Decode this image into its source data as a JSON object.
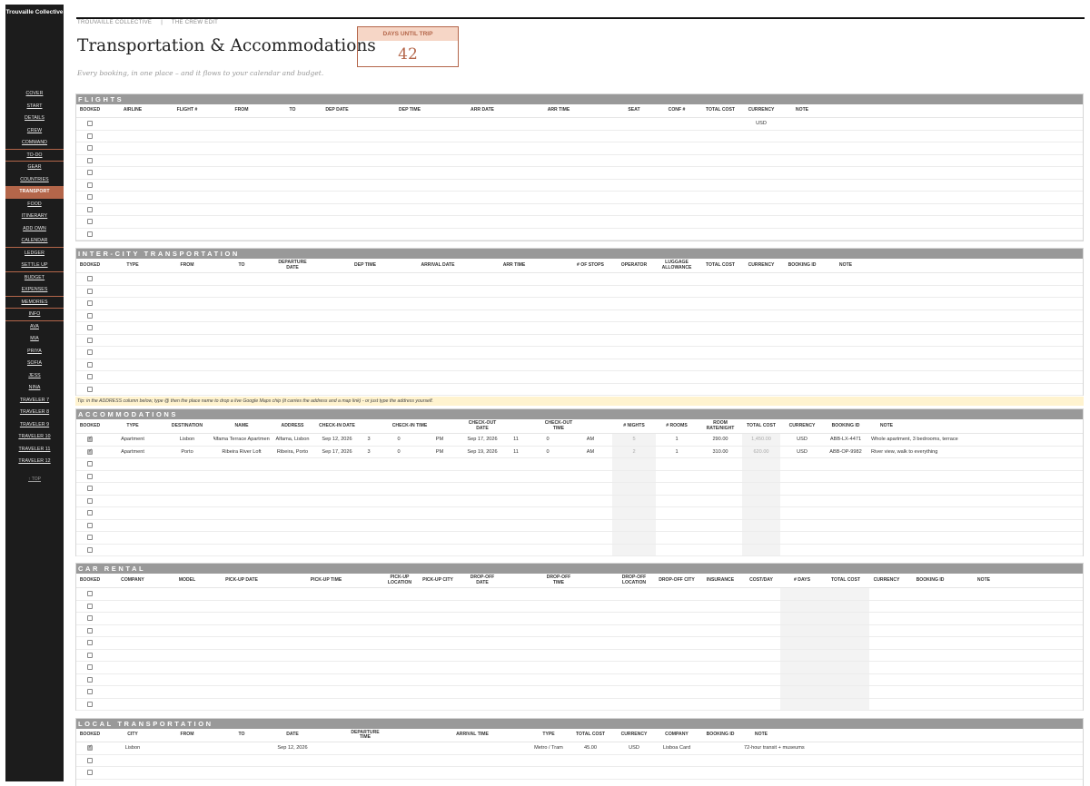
{
  "sidebar": {
    "brand": "Trouvaille Collective",
    "items": [
      {
        "label": "COVER"
      },
      {
        "label": "START"
      },
      {
        "label": "DETAILS"
      },
      {
        "label": "CREW"
      },
      {
        "label": "COMMAND"
      },
      {
        "label": "TO-DO"
      },
      {
        "label": "GEAR"
      },
      {
        "label": "COUNTRIES"
      },
      {
        "label": "TRANSPORT"
      },
      {
        "label": "FOOD"
      },
      {
        "label": "ITINERARY"
      },
      {
        "label": "ADD OWN"
      },
      {
        "label": "CALENDAR"
      },
      {
        "label": "LEDGER"
      },
      {
        "label": "SETTLE UP"
      },
      {
        "label": "BUDGET"
      },
      {
        "label": "EXPENSES"
      },
      {
        "label": "MEMORIES"
      },
      {
        "label": "INFO"
      },
      {
        "label": "AVA"
      },
      {
        "label": "MIA"
      },
      {
        "label": "PRIYA"
      },
      {
        "label": "SOFIA"
      },
      {
        "label": "JESS"
      },
      {
        "label": "NINA"
      },
      {
        "label": "TRAVELER 7"
      },
      {
        "label": "TRAVELER 8"
      },
      {
        "label": "TRAVELER 9"
      },
      {
        "label": "TRAVELER 10"
      },
      {
        "label": "TRAVELER 11"
      },
      {
        "label": "TRAVELER 12"
      }
    ],
    "active": "TRANSPORT",
    "back_to_top": "↑ TOP"
  },
  "header": {
    "breadcrumb": [
      "TROUVAILLE COLLECTIVE",
      "|",
      "THE CREW EDIT"
    ],
    "title": "Transportation & Accommodations",
    "subtitle": "Every booking, in one place – and it flows to your calendar and budget."
  },
  "countdown": {
    "label": "DAYS UNTIL TRIP",
    "value": "42"
  },
  "flights": {
    "title": "FLIGHTS",
    "columns": [
      "BOOKED",
      "AIRLINE",
      "FLIGHT #",
      "FROM",
      "TO",
      "DEP DATE",
      "DEP TIME",
      "ARR DATE",
      "ARR TIME",
      "SEAT",
      "CONF #",
      "TOTAL COST",
      "CURRENCY",
      "NOTE"
    ],
    "first_row_currency": "USD"
  },
  "intercity": {
    "title": "INTER-CITY TRANSPORTATION",
    "columns": [
      "BOOKED",
      "TYPE",
      "FROM",
      "TO",
      "DEPARTURE DATE",
      "DEP TIME",
      "ARRIVAL DATE",
      "ARR TIME",
      "# OF STOPS",
      "OPERATOR",
      "LUGGAGE ALLOWANCE",
      "TOTAL COST",
      "CURRENCY",
      "BOOKING ID",
      "NOTE"
    ]
  },
  "tip": "Tip: in the ADDRESS column below, type  @  then the place name to drop a live Google Maps chip (it carries the address and a map link) - or just type the address yourself.",
  "accommodations": {
    "title": "ACCOMMODATIONS",
    "columns": [
      "BOOKED",
      "TYPE",
      "DESTINATION",
      "NAME",
      "ADDRESS",
      "CHECK-IN DATE",
      "",
      "",
      "CHECK-IN TIME",
      "",
      "CHECK-OUT DATE",
      "",
      "",
      "CHECK-OUT TIME",
      "",
      "# NIGHTS",
      "# ROOMS",
      "ROOM RATE/NIGHT",
      "TOTAL COST",
      "CURRENCY",
      "BOOKING ID",
      "NOTE"
    ],
    "rows": [
      {
        "booked": true,
        "type": "Apartment",
        "destination": "Lisbon",
        "name": "Alfama Terrace Apartment",
        "address": "Alfama, Lisbon",
        "checkin_date": "Sep 12, 2026",
        "ci_h": "3",
        "ci_m": "0",
        "ci_ampm": "PM",
        "checkout_date": "Sep 17, 2026",
        "co_h": "11",
        "co_m": "0",
        "co_ampm": "AM",
        "nights": "5",
        "rooms": "1",
        "rate": "290.00",
        "total": "1,450.00",
        "currency": "USD",
        "booking_id": "ABB-LX-4471",
        "note": "Whole apartment, 3 bedrooms, terrace"
      },
      {
        "booked": true,
        "type": "Apartment",
        "destination": "Porto",
        "name": "Ribeira River Loft",
        "address": "Ribeira, Porto",
        "checkin_date": "Sep 17, 2026",
        "ci_h": "3",
        "ci_m": "0",
        "ci_ampm": "PM",
        "checkout_date": "Sep 19, 2026",
        "co_h": "11",
        "co_m": "0",
        "co_ampm": "AM",
        "nights": "2",
        "rooms": "1",
        "rate": "310.00",
        "total": "620.00",
        "currency": "USD",
        "booking_id": "ABB-OP-9982",
        "note": "River view, walk to everything"
      }
    ]
  },
  "car_rental": {
    "title": "CAR RENTAL",
    "columns": [
      "BOOKED",
      "COMPANY",
      "MODEL",
      "PICK-UP DATE",
      "PICK-UP TIME",
      "PICK-UP LOCATION",
      "PICK-UP CITY",
      "DROP-OFF DATE",
      "DROP-OFF TIME",
      "DROP-OFF LOCATION",
      "DROP-OFF CITY",
      "INSURANCE",
      "COST/DAY",
      "# DAYS",
      "TOTAL COST",
      "CURRENCY",
      "BOOKING ID",
      "NOTE"
    ]
  },
  "local": {
    "title": "LOCAL TRANSPORTATION",
    "columns": [
      "BOOKED",
      "CITY",
      "FROM",
      "TO",
      "DATE",
      "DEPARTURE TIME",
      "ARRIVAL TIME",
      "TYPE",
      "TOTAL COST",
      "CURRENCY",
      "COMPANY",
      "BOOKING ID",
      "NOTE"
    ],
    "rows": [
      {
        "booked": true,
        "city": "Lisbon",
        "from": "",
        "to": "",
        "date": "Sep 12, 2026",
        "dep": "",
        "arr": "",
        "type": "Metro / Tram",
        "total": "45.00",
        "currency": "USD",
        "company": "Lisboa Card",
        "booking_id": "",
        "note": "72-hour transit + museums"
      }
    ]
  }
}
